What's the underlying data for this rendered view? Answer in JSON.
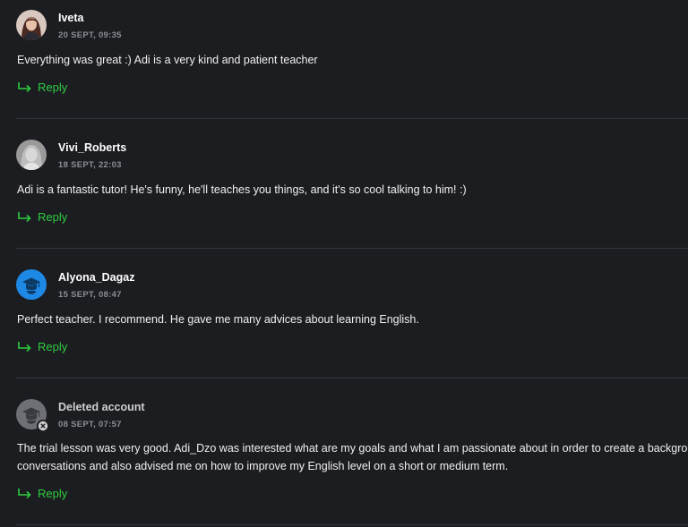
{
  "reviews": [
    {
      "author": "Iveta",
      "date": "20 SEPT, 09:35",
      "avatar": "photo-avatar-woman",
      "lines": [
        "Everything was great :) Adi is a very kind and patient teacher"
      ],
      "reply_label": "Reply"
    },
    {
      "author": "Vivi_Roberts",
      "date": "18 SEPT, 22:03",
      "avatar": "photo-avatar-grayscale",
      "lines": [
        "Adi is a fantastic tutor! He's funny, he'll teaches you things, and it's so cool talking to him! :)"
      ],
      "reply_label": "Reply"
    },
    {
      "author": "Alyona_Dagaz",
      "date": "15 SEPT, 08:47",
      "avatar": "student-cap-avatar-blue",
      "lines": [
        "Perfect teacher. I recommend. He gave me many advices about learning English."
      ],
      "reply_label": "Reply"
    },
    {
      "author": "Deleted account",
      "date": "08 SEPT, 07:57",
      "avatar": "student-cap-avatar-gray-deleted",
      "lines": [
        "The trial lesson was very good. Adi_Dzo was interested what are my goals and what I am passionate about in order to create a backgrou",
        "conversations and also advised me on how to improve my English level on a short or medium term."
      ],
      "reply_label": "Reply"
    }
  ],
  "colors": {
    "background": "#1c1d21",
    "accent_green": "#2ecc40",
    "date_gray": "#8b8d93",
    "divider": "#33353a",
    "avatar_blue": "#1e88e5"
  }
}
